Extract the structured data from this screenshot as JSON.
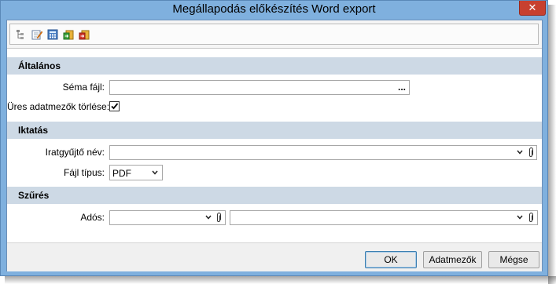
{
  "window": {
    "title": "Megállapodás előkészítés Word export",
    "close_glyph": "✕"
  },
  "toolbar": {
    "icons": [
      "tree-icon",
      "edit-icon",
      "calculator-icon",
      "export-green-icon",
      "export-red-icon"
    ]
  },
  "sections": {
    "general": {
      "header": "Általános",
      "schema_label": "Séma fájl:",
      "schema_value": "",
      "schema_browse": "...",
      "clear_label": "Üres adatmezők törlése:",
      "clear_checked": true
    },
    "filing": {
      "header": "Iktatás",
      "folder_label": "Iratgyűjtő név:",
      "folder_value": "",
      "filetype_label": "Fájl típus:",
      "filetype_value": "PDF"
    },
    "filter": {
      "header": "Szűrés",
      "debtor_label": "Adós:",
      "debtor_value1": "",
      "debtor_value2": ""
    }
  },
  "footer": {
    "ok": "OK",
    "fields": "Adatmezők",
    "cancel": "Mégse"
  },
  "colors": {
    "frame": "#7fb0de",
    "section": "#cdd9e5",
    "close": "#c7402f"
  }
}
